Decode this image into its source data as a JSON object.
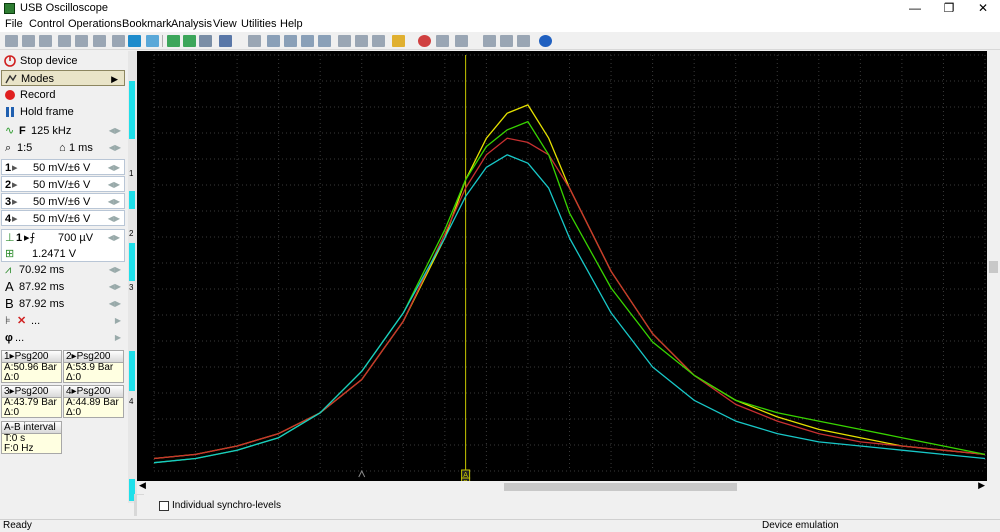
{
  "window": {
    "title": "USB Oscilloscope"
  },
  "menu": [
    "File",
    "Control",
    "Operations",
    "Bookmark",
    "Analysis",
    "View",
    "Utilities",
    "Help"
  ],
  "left_panel": {
    "stop_device": "Stop device",
    "modes": "Modes",
    "record": "Record",
    "hold_frame": "Hold frame",
    "sample_rate": "125 kHz",
    "zoom": "1:5",
    "timebase": "1 ms",
    "channels": [
      {
        "num": "1",
        "label": "50 mV/±6 V"
      },
      {
        "num": "2",
        "label": "50 mV/±6 V"
      },
      {
        "num": "3",
        "label": "50 mV/±6 V"
      },
      {
        "num": "4",
        "label": "50 mV/±6 V"
      }
    ],
    "trigger_channel": "1",
    "trigger_level": "700 µV",
    "trigger_voltage": "1.2471 V",
    "delay": "70.92 ms",
    "cursor_a": "87.92 ms",
    "cursor_b": "87.92 ms",
    "filter_label": "...",
    "phase_label": "..."
  },
  "measurements": [
    {
      "header": "1▸Psg200",
      "a": "A:50.96 Bar",
      "d": "Δ:0"
    },
    {
      "header": "2▸Psg200",
      "a": "A:53.9 Bar",
      "d": "Δ:0"
    },
    {
      "header": "3▸Psg200",
      "a": "A:43.79 Bar",
      "d": "Δ:0"
    },
    {
      "header": "4▸Psg200",
      "a": "A:44.89 Bar",
      "d": "Δ:0"
    }
  ],
  "ab_interval": {
    "header": "A-B interval",
    "t": "T:0 s",
    "f": "F:0 Hz"
  },
  "strip_numbers": [
    "1",
    "2",
    "3",
    "4"
  ],
  "cursor_labels": {
    "a": "A",
    "b": "B"
  },
  "individual_synchro": "Individual synchro-levels",
  "status": {
    "left": "Ready",
    "right": "Device emulation"
  },
  "colors": {
    "ch1": "#e4e000",
    "ch2": "#c83030",
    "ch3": "#38d400",
    "ch4": "#18c8c8",
    "cursor": "#c8c800",
    "grid": "#3a3a3a"
  },
  "chart_data": {
    "type": "line",
    "series": [
      {
        "name": "",
        "color": "#e4e000",
        "x": [
          0,
          10,
          20,
          30,
          40,
          50,
          60,
          70,
          75,
          80,
          85,
          90,
          95,
          100,
          110,
          120,
          130,
          140,
          150,
          160,
          170,
          180,
          190,
          200
        ],
        "y": [
          3,
          4,
          6,
          9,
          14,
          22,
          36,
          56,
          70,
          80,
          86,
          88,
          80,
          68,
          48,
          33,
          23,
          17,
          13,
          10,
          8,
          6,
          5,
          4
        ]
      },
      {
        "name": "",
        "color": "#c83030",
        "x": [
          0,
          10,
          20,
          30,
          40,
          50,
          60,
          70,
          75,
          80,
          85,
          90,
          95,
          100,
          110,
          120,
          130,
          140,
          150,
          160,
          170,
          180,
          190,
          200
        ],
        "y": [
          3,
          4,
          6,
          9,
          14,
          22,
          36,
          57,
          68,
          76,
          80,
          79,
          76,
          68,
          48,
          33,
          23,
          16,
          12,
          9,
          7,
          6,
          5,
          4
        ]
      },
      {
        "name": "",
        "color": "#38d400",
        "x": [
          0,
          10,
          20,
          30,
          40,
          50,
          60,
          70,
          75,
          80,
          85,
          90,
          95,
          100,
          110,
          120,
          130,
          140,
          150,
          160,
          170,
          180,
          190,
          200
        ],
        "y": [
          2,
          3,
          5,
          8,
          14,
          24,
          38,
          58,
          70,
          78,
          82,
          84,
          76,
          62,
          44,
          31,
          23,
          17,
          14,
          12,
          10,
          8,
          6,
          4
        ]
      },
      {
        "name": "",
        "color": "#18c8c8",
        "x": [
          0,
          10,
          20,
          30,
          40,
          50,
          60,
          70,
          75,
          80,
          85,
          90,
          95,
          100,
          110,
          120,
          130,
          140,
          150,
          160,
          170,
          180,
          190,
          200
        ],
        "y": [
          2,
          3,
          5,
          8,
          14,
          24,
          38,
          56,
          66,
          73,
          76,
          74,
          68,
          56,
          38,
          25,
          17,
          12,
          9,
          7,
          6,
          5,
          4,
          3
        ]
      }
    ],
    "xlim": [
      0,
      200
    ],
    "ylim": [
      0,
      100
    ],
    "grid": true,
    "cursor_x": 75
  }
}
